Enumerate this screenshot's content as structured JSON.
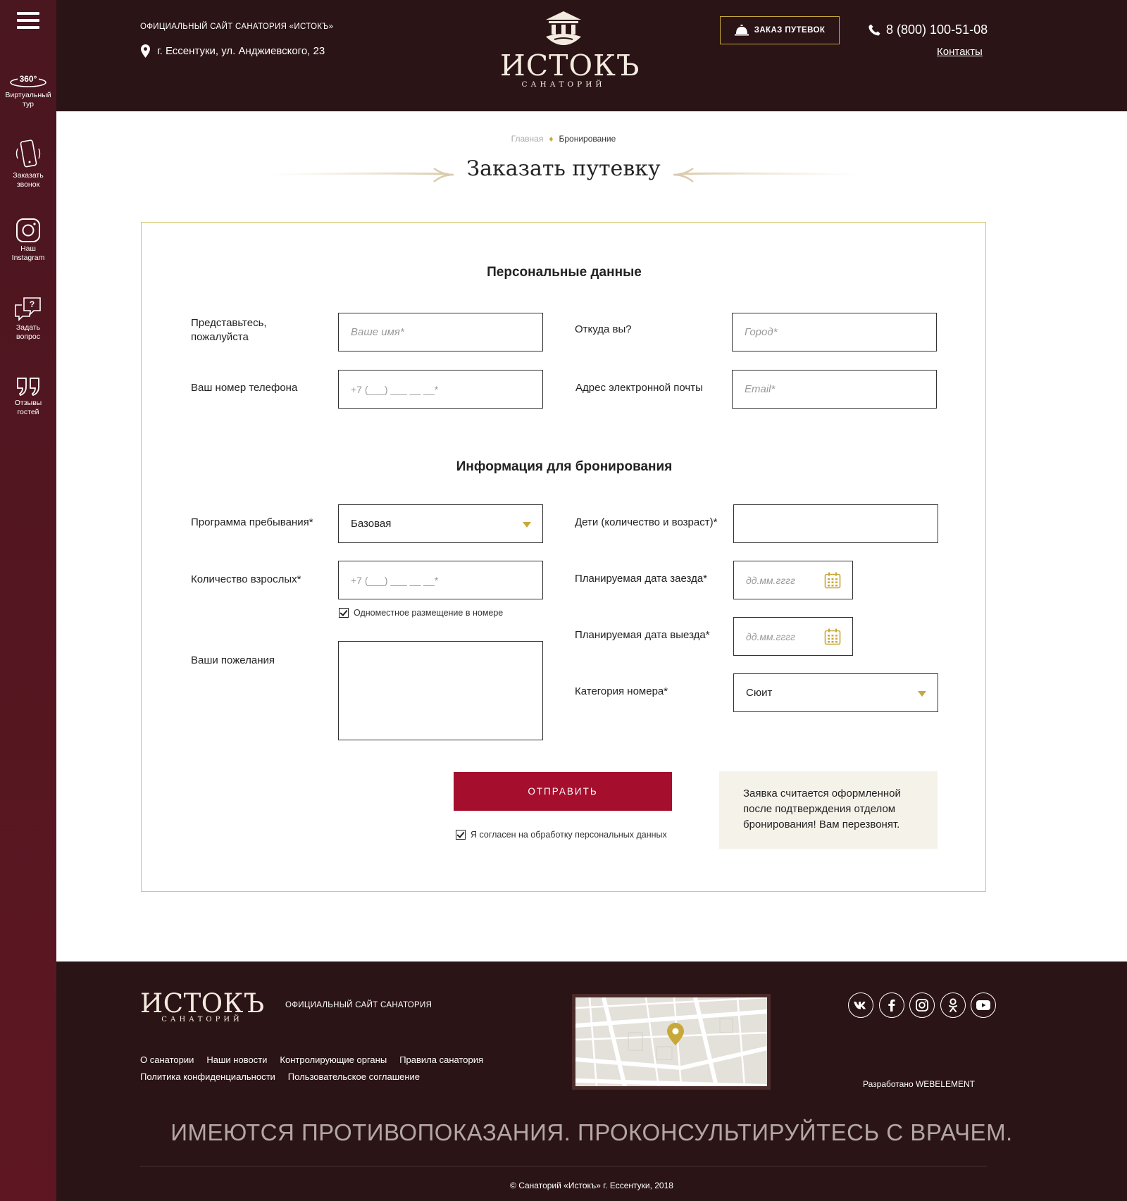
{
  "rail": {
    "items": [
      {
        "icon": "360-tour-icon",
        "icon_text": "360°",
        "label_1": "Виртуальный",
        "label_2": "тур"
      },
      {
        "icon": "phone-ring-icon",
        "label_1": "Заказать",
        "label_2": "звонок"
      },
      {
        "icon": "instagram-icon",
        "label_1": "Наш",
        "label_2": "Instagram"
      },
      {
        "icon": "question-chat-icon",
        "label_1": "Задать",
        "label_2": "вопрос"
      },
      {
        "icon": "quote-icon",
        "label_1": "Отзывы",
        "label_2": "гостей"
      }
    ]
  },
  "header": {
    "site_tag": "Официальный сайт санатория «Истокъ»",
    "address": "г. Ессентуки, ул. Анджиевского, 23",
    "logo_name": "ИСТОКЪ",
    "logo_sub": "САНАТОРИЙ",
    "order_button": "Заказ путевок",
    "phone": "8 (800) 100-51-08",
    "contacts_link": "Контакты"
  },
  "breadcrumb": {
    "home": "Главная",
    "current": "Бронирование"
  },
  "page_title": "Заказать путевку",
  "form": {
    "personal_title": "Персональные данные",
    "name_label_1": "Представьтесь,",
    "name_label_2": "пожалуйста",
    "name_placeholder": "Ваше имя*",
    "city_label": "Откуда вы?",
    "city_placeholder": "Город*",
    "phone_label": "Ваш номер телефона",
    "phone_mask": "+7 (___) ___ __ __*",
    "email_label": "Адрес электронной почты",
    "email_placeholder": "Email*",
    "booking_title": "Информация для бронирования",
    "program_label": "Программа пребывания*",
    "program_value": "Базовая",
    "children_label": "Дети (количество и возраст)*",
    "children_value": "",
    "adults_label": "Количество взрослых*",
    "adults_mask": "+7 (___) ___ __ __*",
    "single_checkbox": "Одноместное размещение в номере",
    "single_checked": true,
    "checkin_label": "Планируемая дата заезда*",
    "checkin_placeholder": "дд.мм.гггг",
    "checkout_label": "Планируемая дата выезда*",
    "checkout_placeholder": "дд.мм.гггг",
    "wishes_label": "Ваши пожелания",
    "wishes_value": "",
    "category_label": "Категория номера*",
    "category_value": "Сюит",
    "submit": "Отправить",
    "consent": "Я согласен на обработку персональных данных",
    "consent_checked": true,
    "note": "Заявка считается оформленной после подтверждения отделом бронирования! Вам перезвонят."
  },
  "footer": {
    "logo_name": "ИСТОКЪ",
    "logo_sub": "САНАТОРИЙ",
    "tag": "Официальный сайт санатория",
    "links_row1": [
      "О санатории",
      "Наши новости",
      "Контролирующие органы",
      "Правила санатория"
    ],
    "links_row2": [
      "Политика конфиденциальности",
      "Пользовательское соглашение"
    ],
    "social": [
      "vk-icon",
      "facebook-icon",
      "instagram-icon",
      "odnoklassniki-icon",
      "youtube-icon"
    ],
    "developer": "Разработано WEBELEMENT",
    "warning": "ИМЕЮТСЯ ПРОТИВОПОКАЗАНИЯ. ПРОКОНСУЛЬТИРУЙТЕСЬ С ВРАЧЕМ.",
    "copyright": "© Санаторий «Истокъ» г. Ессентуки, 2018"
  },
  "colors": {
    "header_bg": "#2b1416",
    "rail_bg": "#4a1620",
    "accent_gold": "#c8a83a",
    "submit_red": "#a50f2d",
    "note_bg": "#f5f2ea"
  }
}
